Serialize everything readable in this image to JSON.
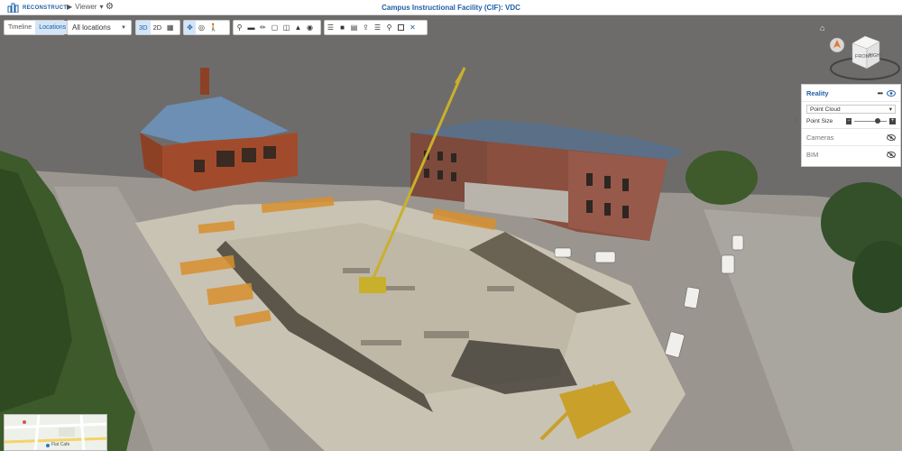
{
  "app": {
    "logo_text": "RECONSTRUCT",
    "viewer_menu_label": "Viewer",
    "title": "Campus Instructional Facility (CIF): VDC"
  },
  "toolbar": {
    "view_modes": [
      {
        "label": "Timeline",
        "active": false
      },
      {
        "label": "Locations",
        "active": true
      }
    ],
    "location_select": {
      "value": "All locations"
    },
    "dimension_modes": [
      {
        "label": "3D",
        "active": true
      },
      {
        "label": "2D",
        "active": false
      }
    ]
  },
  "panel": {
    "title": "Reality",
    "dots": "•••",
    "pointcloud_select": {
      "value": "Point Cloud"
    },
    "point_size": {
      "label": "Point Size",
      "level_percent": 70
    },
    "rows": [
      {
        "label": "Cameras"
      },
      {
        "label": "BIM"
      }
    ]
  },
  "navcube": {
    "front_label": "FRONT",
    "right_label": "RIGHT"
  },
  "minimap": {
    "label": "Flat Cafe"
  },
  "colors": {
    "brand_blue": "#1f5fa8",
    "active_bg": "#d4e5f7",
    "sky": "#6d6b69"
  }
}
